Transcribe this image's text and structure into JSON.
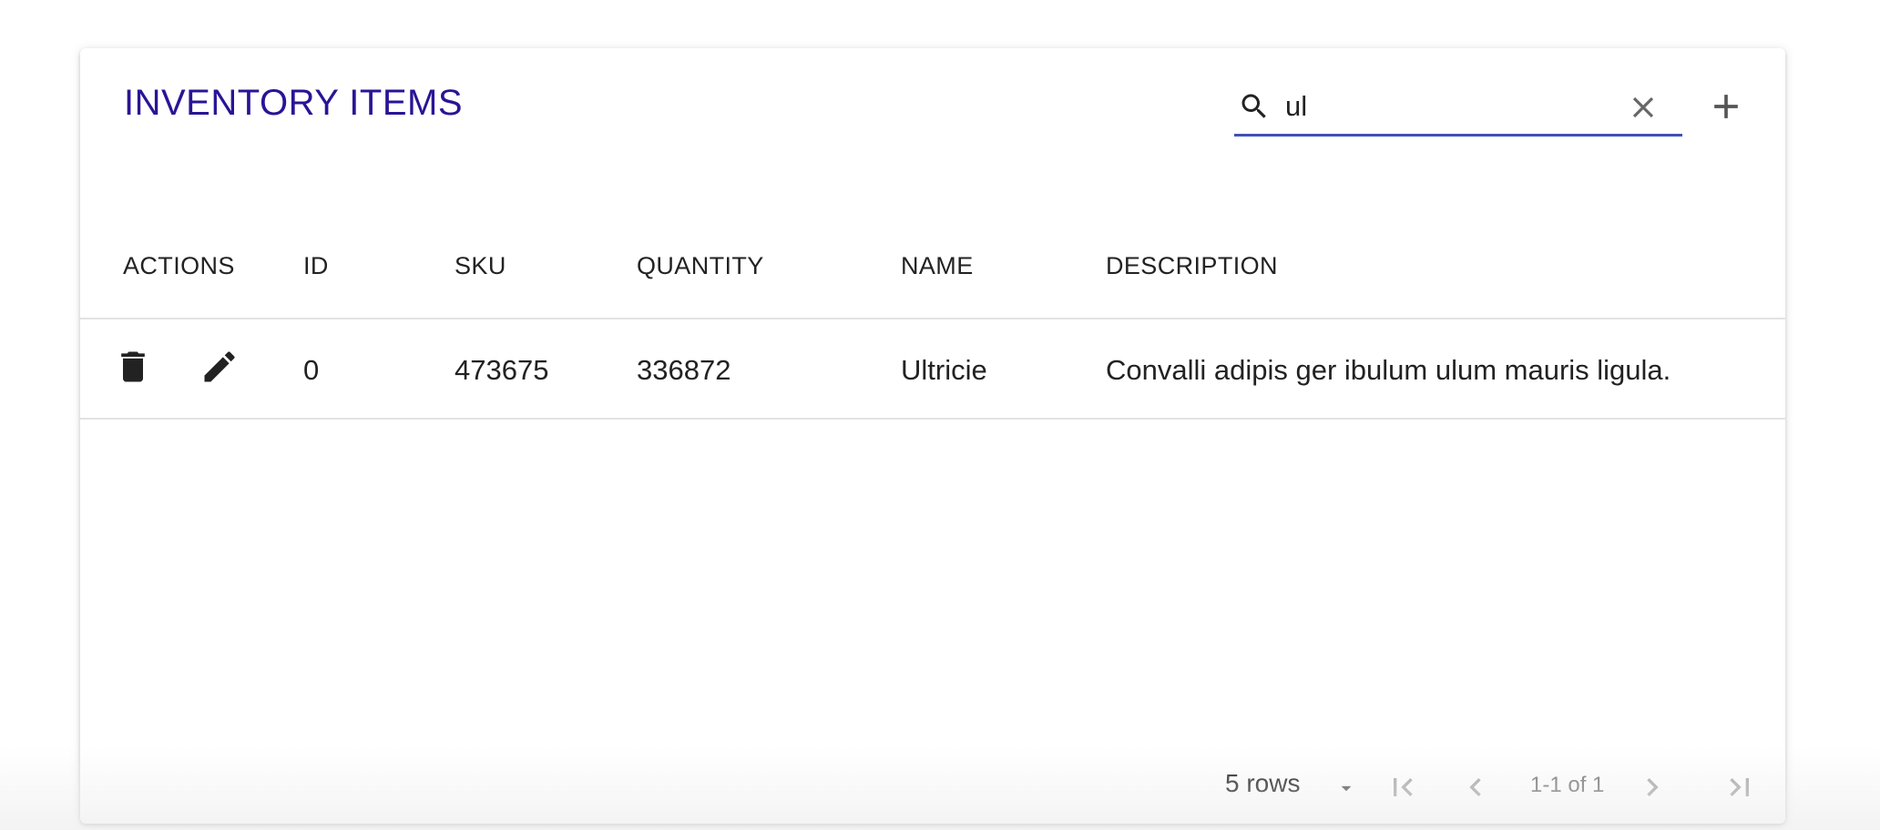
{
  "header": {
    "title": "INVENTORY ITEMS"
  },
  "search": {
    "value": "ul",
    "placeholder": "Search",
    "icon": "search-icon",
    "clear_icon": "close-icon"
  },
  "toolbar": {
    "add_icon": "plus-icon"
  },
  "table": {
    "columns": [
      "ACTIONS",
      "ID",
      "SKU",
      "QUANTITY",
      "NAME",
      "DESCRIPTION"
    ],
    "rows": [
      {
        "id": "0",
        "sku": "473675",
        "quantity": "336872",
        "name": "Ultricie",
        "description": "Convalli adipis ger ibulum ulum mauris ligula."
      }
    ]
  },
  "pagination": {
    "rows_per_page": "5 rows",
    "range": "1-1 of 1"
  },
  "colors": {
    "accent": "#3f51b5",
    "title": "#2a1496"
  }
}
